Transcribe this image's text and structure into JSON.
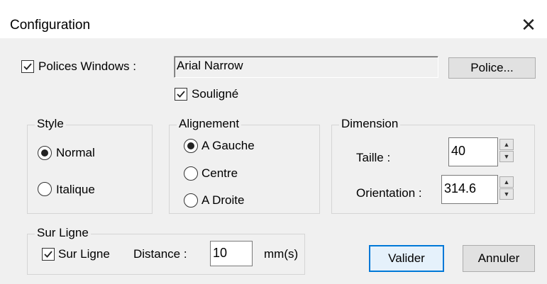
{
  "window": {
    "title": "Configuration",
    "close_glyph": "✕"
  },
  "fonts_section": {
    "windows_fonts_label": "Polices Windows :",
    "windows_fonts_checked": true,
    "font_name": "Arial Narrow",
    "font_button": "Police...",
    "underline_label": "Souligné",
    "underline_checked": true
  },
  "style": {
    "caption": "Style",
    "options": [
      "Normal",
      "Italique"
    ],
    "selected": "Normal"
  },
  "alignment": {
    "caption": "Alignement",
    "options": [
      "A Gauche",
      "Centre",
      "A Droite"
    ],
    "selected": "A Gauche"
  },
  "dimension": {
    "caption": "Dimension",
    "size_label": "Taille :",
    "size_value": "40",
    "orientation_label": "Orientation :",
    "orientation_value": "314.6"
  },
  "overline": {
    "caption": "Sur Ligne",
    "checkbox_label": "Sur Ligne",
    "checked": true,
    "distance_label": "Distance :",
    "distance_value": "10",
    "unit": "mm(s)"
  },
  "buttons": {
    "ok": "Valider",
    "cancel": "Annuler"
  }
}
